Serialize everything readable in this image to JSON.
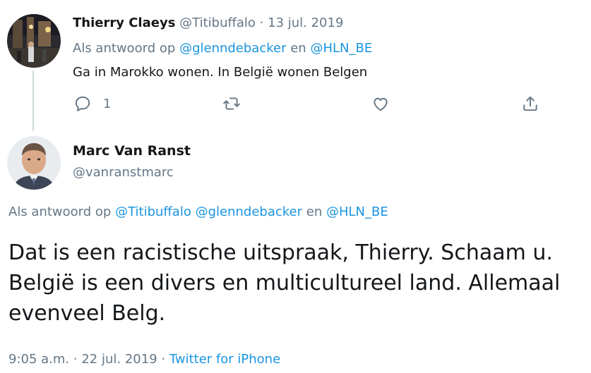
{
  "reply_tweet": {
    "author_name": "Thierry Claeys",
    "author_handle": "@Titibuffalo",
    "separator": "·",
    "date": "13 jul. 2019",
    "reply_prefix": "Als antwoord op",
    "reply_mention_1": "@glenndebacker",
    "reply_conjunction": "en",
    "reply_mention_2": "@HLN_BE",
    "text": "Ga in Marokko wonen. In België wonen Belgen",
    "actions": {
      "reply_icon": "reply-icon",
      "reply_count": "1",
      "retweet_icon": "retweet-icon",
      "like_icon": "heart-icon",
      "share_icon": "share-icon"
    }
  },
  "main_tweet": {
    "author_name": "Marc Van Ranst",
    "author_handle": "@vanranstmarc",
    "reply_prefix": "Als antwoord op",
    "reply_mention_1": "@Titibuffalo",
    "reply_mention_2": "@glenndebacker",
    "reply_conjunction": "en",
    "reply_mention_3": "@HLN_BE",
    "text": "Dat is een racistische uitspraak, Thierry. Schaam u. België is een divers en multicultureel land. Allemaal evenveel Belg.",
    "time": "9:05 a.m.",
    "separator": "·",
    "date": "22 jul. 2019",
    "source": "Twitter for iPhone"
  },
  "colors": {
    "link": "#1b95e0",
    "muted": "#657786",
    "text": "#14171a",
    "thread_line": "#cfd9de"
  }
}
